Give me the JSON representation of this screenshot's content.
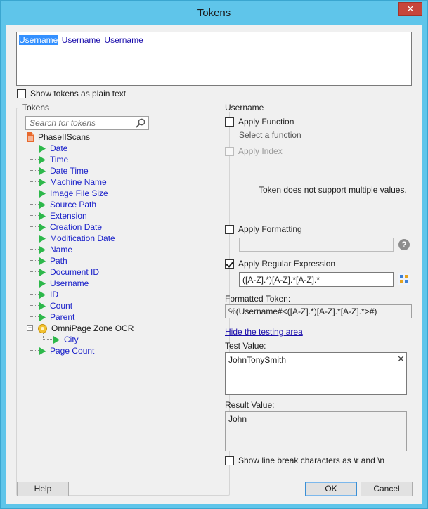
{
  "window": {
    "title": "Tokens",
    "close_glyph": "✕"
  },
  "token_box": {
    "tokens": [
      "Username",
      "Username",
      "Username"
    ]
  },
  "show_plain_text": {
    "label": "Show tokens as plain text",
    "checked": false
  },
  "tokens_panel": {
    "title": "Tokens",
    "search_placeholder": "Search for tokens",
    "root": {
      "label": "PhaseIIScans",
      "icon": "document-icon"
    },
    "items": [
      "Date",
      "Time",
      "Date Time",
      "Machine Name",
      "Image File Size",
      "Source Path",
      "Extension",
      "Creation Date",
      "Modification Date",
      "Name",
      "Path",
      "Document ID",
      "Username",
      "ID",
      "Count",
      "Parent"
    ],
    "zone": {
      "label": "OmniPage Zone OCR",
      "icon": "zone-icon",
      "children": [
        "City"
      ]
    },
    "after_zone": [
      "Page Count"
    ]
  },
  "username_panel": {
    "title": "Username",
    "apply_function": {
      "label": "Apply Function",
      "checked": false,
      "hint": "Select a function"
    },
    "apply_index": {
      "label": "Apply Index",
      "checked": false,
      "disabled": true
    },
    "multi_note": "Token does not support multiple values.",
    "apply_formatting": {
      "label": "Apply Formatting",
      "checked": false,
      "help_glyph": "?"
    },
    "apply_regex": {
      "label": "Apply Regular Expression",
      "checked": true,
      "value": "([A-Z].*)[A-Z].*[A-Z].*"
    },
    "formatted_token": {
      "label": "Formatted Token:",
      "value": "%(Username#<([A-Z].*)[A-Z].*[A-Z].*>#)"
    },
    "hide_testing_link": "Hide the testing area",
    "test_value": {
      "label": "Test Value:",
      "value": "JohnTonySmith",
      "clear_glyph": "✕"
    },
    "result_value": {
      "label": "Result Value:",
      "value": "John"
    },
    "line_break": {
      "label": "Show line break characters as \\r and \\n",
      "checked": false
    }
  },
  "buttons": {
    "help": "Help",
    "ok": "OK",
    "cancel": "Cancel"
  },
  "colors": {
    "title_bar": "#5fc5ea",
    "close_button": "#c7463b",
    "link": "#1a0dab",
    "tree_text": "#1a21c9",
    "tree_triangle": "#2db84a",
    "selection": "#3390ff"
  }
}
